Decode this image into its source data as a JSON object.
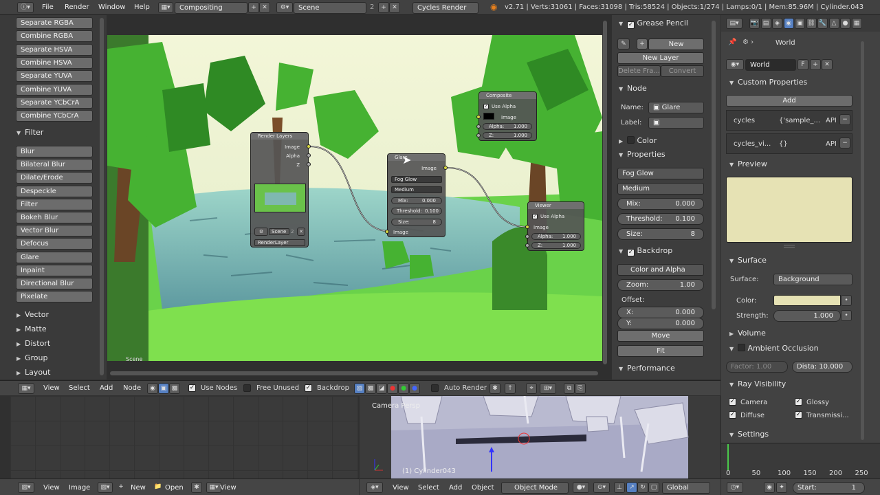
{
  "topbar": {
    "menus": [
      "File",
      "Render",
      "Window",
      "Help"
    ],
    "screen": "Compositing",
    "scene": "Scene",
    "scene_users": "2",
    "engine": "Cycles Render",
    "stats": "v2.71 | Verts:31061 | Faces:31098 | Tris:58524 | Objects:1/274 | Lamps:0/1 | Mem:85.96M | Cylinder.043"
  },
  "left": {
    "buttons_top": [
      "Separate RGBA",
      "Combine RGBA",
      "Separate HSVA",
      "Combine HSVA",
      "Separate YUVA",
      "Combine YUVA",
      "Separate YCbCrA",
      "Combine YCbCrA"
    ],
    "filter_label": "Filter",
    "filter_items": [
      "Blur",
      "Bilateral Blur",
      "Dilate/Erode",
      "Despeckle",
      "Filter",
      "Bokeh Blur",
      "Vector Blur",
      "Defocus",
      "Glare",
      "Inpaint",
      "Directional Blur",
      "Pixelate"
    ],
    "collapsed": [
      "Vector",
      "Matte",
      "Distort",
      "Group",
      "Layout"
    ]
  },
  "viewport": {
    "backdrop_label": "Scene"
  },
  "nodes": {
    "render_layers": {
      "title": "Render Layers",
      "outputs": [
        "Image",
        "Alpha",
        "Z"
      ],
      "scene": "Scene",
      "scene_users": "2",
      "layer": "RenderLayer"
    },
    "glare": {
      "title": "Glare",
      "output": "Image",
      "type": "Fog Glow",
      "quality": "Medium",
      "mix_label": "Mix:",
      "mix": "0.000",
      "threshold_label": "Threshold:",
      "threshold": "0.100",
      "size_label": "Size:",
      "size": "8",
      "input": "Image"
    },
    "composite": {
      "title": "Composite",
      "use_alpha": "Use Alpha",
      "inputs": [
        "Image"
      ],
      "alpha_label": "Alpha:",
      "alpha": "1.000",
      "z_label": "Z:",
      "z": "1.000"
    },
    "viewer": {
      "title": "Viewer",
      "use_alpha": "Use Alpha",
      "inputs": [
        "Image"
      ],
      "alpha_label": "Alpha:",
      "alpha": "1.000",
      "z_label": "Z:",
      "z": "1.000"
    }
  },
  "props": {
    "grease_pencil": "Grease Pencil",
    "new": "New",
    "new_layer": "New Layer",
    "delete_frame": "Delete Fra...",
    "convert": "Convert",
    "node_section": "Node",
    "name_label": "Name:",
    "name_value": "Glare",
    "label_label": "Label:",
    "color_section": "Color",
    "properties_section": "Properties",
    "glare_type": "Fog Glow",
    "quality": "Medium",
    "mix_label": "Mix:",
    "mix": "0.000",
    "threshold_label": "Threshold:",
    "threshold": "0.100",
    "size_label": "Size:",
    "size": "8",
    "backdrop_section": "Backdrop",
    "channels": "Color and Alpha",
    "zoom_label": "Zoom:",
    "zoom": "1.00",
    "offset_label": "Offset:",
    "x_label": "X:",
    "x": "0.000",
    "y_label": "Y:",
    "y": "0.000",
    "move": "Move",
    "fit": "Fit",
    "performance": "Performance"
  },
  "node_header": {
    "menus": [
      "View",
      "Select",
      "Add",
      "Node"
    ],
    "use_nodes": "Use Nodes",
    "free_unused": "Free Unused",
    "backdrop": "Backdrop",
    "auto_render": "Auto Render"
  },
  "right": {
    "breadcrumb": "World",
    "world_name": "World",
    "world_users": "F",
    "custom_props": "Custom Properties",
    "add": "Add",
    "prop1_name": "cycles",
    "prop1_value": "{'sample_...",
    "prop1_api": "API",
    "prop2_name": "cycles_vi...",
    "prop2_value": "{}",
    "prop2_api": "API",
    "preview": "Preview",
    "surface_section": "Surface",
    "surface_label": "Surface:",
    "surface_value": "Background",
    "color_label": "Color:",
    "strength_label": "Strength:",
    "strength": "1.000",
    "volume": "Volume",
    "ambient_occlusion": "Ambient Occlusion",
    "factor": "Factor:    1.00",
    "distance": "Dista: 10.000",
    "ray_visibility": "Ray Visibility",
    "camera": "Camera",
    "glossy": "Glossy",
    "diffuse": "Diffuse",
    "transmission": "Transmissi...",
    "settings": "Settings",
    "timeline_ticks": [
      "0",
      "50",
      "100",
      "150",
      "200",
      "250"
    ],
    "start_label": "Start:",
    "start_value": "1",
    "preview_color": "#e6e2b4"
  },
  "viewport3d": {
    "label": "Camera Persp",
    "object": "(1) Cylinder043"
  },
  "bottom_left": {
    "menus": [
      "View",
      "Image"
    ],
    "new": "New",
    "open": "Open",
    "view": "View"
  },
  "bottom_mid": {
    "menus": [
      "View",
      "Select",
      "Add",
      "Object"
    ],
    "mode": "Object Mode",
    "orientation": "Global"
  }
}
